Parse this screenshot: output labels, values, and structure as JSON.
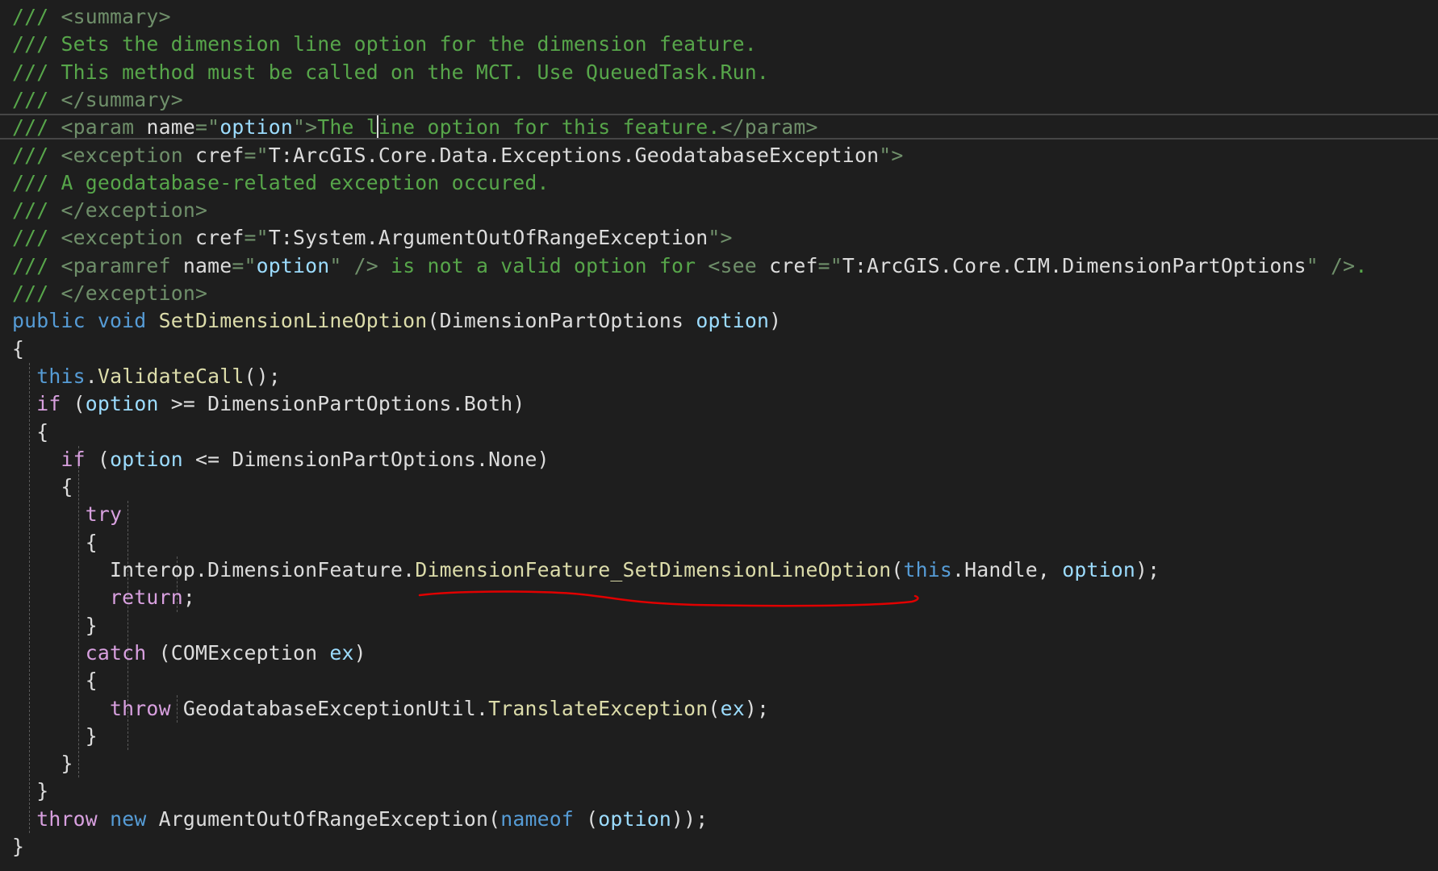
{
  "editor": {
    "language": "csharp",
    "lines": [
      [
        [
          "comment",
          "/// "
        ],
        [
          "xmltag",
          "<summary>"
        ]
      ],
      [
        [
          "comment",
          "/// Sets the dimension line option for the dimension feature."
        ]
      ],
      [
        [
          "comment",
          "/// This method must be called on the MCT. Use QueuedTask.Run."
        ]
      ],
      [
        [
          "comment",
          "/// "
        ],
        [
          "xmltag",
          "</summary>"
        ]
      ],
      [
        [
          "comment",
          "/// "
        ],
        [
          "xmltag",
          "<param "
        ],
        [
          "attr",
          "name"
        ],
        [
          "xmltag",
          "=\""
        ],
        [
          "attrval-b",
          "option"
        ],
        [
          "xmltag",
          "\">"
        ],
        [
          "comment",
          "The line option for this feature."
        ],
        [
          "xmltag",
          "</param>"
        ]
      ],
      [
        [
          "comment",
          "/// "
        ],
        [
          "xmltag",
          "<exception "
        ],
        [
          "attr",
          "cref"
        ],
        [
          "xmltag",
          "=\""
        ],
        [
          "attrval",
          "T:ArcGIS.Core.Data.Exceptions.GeodatabaseException"
        ],
        [
          "xmltag",
          "\">"
        ]
      ],
      [
        [
          "comment",
          "/// A geodatabase-related exception occured."
        ]
      ],
      [
        [
          "comment",
          "/// "
        ],
        [
          "xmltag",
          "</exception>"
        ]
      ],
      [
        [
          "comment",
          "/// "
        ],
        [
          "xmltag",
          "<exception "
        ],
        [
          "attr",
          "cref"
        ],
        [
          "xmltag",
          "=\""
        ],
        [
          "attrval",
          "T:System.ArgumentOutOfRangeException"
        ],
        [
          "xmltag",
          "\">"
        ]
      ],
      [
        [
          "comment",
          "/// "
        ],
        [
          "xmltag",
          "<paramref "
        ],
        [
          "attr",
          "name"
        ],
        [
          "xmltag",
          "=\""
        ],
        [
          "attrval-b",
          "option"
        ],
        [
          "xmltag",
          "\" />"
        ],
        [
          "comment",
          " is not a valid option for "
        ],
        [
          "xmltag",
          "<see "
        ],
        [
          "attr",
          "cref"
        ],
        [
          "xmltag",
          "=\""
        ],
        [
          "attrval",
          "T:ArcGIS.Core.CIM.DimensionPartOptions"
        ],
        [
          "xmltag",
          "\" />"
        ],
        [
          "comment",
          "."
        ]
      ],
      [
        [
          "comment",
          "/// "
        ],
        [
          "xmltag",
          "</exception>"
        ]
      ],
      [
        [
          "keyword",
          "public"
        ],
        [
          "plain",
          " "
        ],
        [
          "keyword",
          "void"
        ],
        [
          "plain",
          " "
        ],
        [
          "method",
          "SetDimensionLineOption"
        ],
        [
          "plain",
          "("
        ],
        [
          "type",
          "DimensionPartOptions"
        ],
        [
          "plain",
          " "
        ],
        [
          "param",
          "option"
        ],
        [
          "plain",
          ")"
        ]
      ],
      [
        [
          "plain",
          "{"
        ]
      ],
      [
        [
          "plain",
          "  "
        ],
        [
          "keyword",
          "this"
        ],
        [
          "plain",
          "."
        ],
        [
          "method",
          "ValidateCall"
        ],
        [
          "plain",
          "();"
        ]
      ],
      [
        [
          "plain",
          "  "
        ],
        [
          "control",
          "if"
        ],
        [
          "plain",
          " ("
        ],
        [
          "param",
          "option"
        ],
        [
          "plain",
          " >= "
        ],
        [
          "type",
          "DimensionPartOptions"
        ],
        [
          "plain",
          ".Both)"
        ]
      ],
      [
        [
          "plain",
          "  {"
        ]
      ],
      [
        [
          "plain",
          "    "
        ],
        [
          "control",
          "if"
        ],
        [
          "plain",
          " ("
        ],
        [
          "param",
          "option"
        ],
        [
          "plain",
          " <= "
        ],
        [
          "type",
          "DimensionPartOptions"
        ],
        [
          "plain",
          ".None)"
        ]
      ],
      [
        [
          "plain",
          "    {"
        ]
      ],
      [
        [
          "plain",
          "      "
        ],
        [
          "control",
          "try"
        ]
      ],
      [
        [
          "plain",
          "      {"
        ]
      ],
      [
        [
          "plain",
          "        "
        ],
        [
          "type",
          "Interop"
        ],
        [
          "plain",
          "."
        ],
        [
          "type",
          "DimensionFeature"
        ],
        [
          "plain",
          "."
        ],
        [
          "method",
          "DimensionFeature_SetDimensionLineOption"
        ],
        [
          "plain",
          "("
        ],
        [
          "keyword",
          "this"
        ],
        [
          "plain",
          ".Handle, "
        ],
        [
          "param",
          "option"
        ],
        [
          "plain",
          ");"
        ]
      ],
      [
        [
          "plain",
          "        "
        ],
        [
          "control",
          "return"
        ],
        [
          "plain",
          ";"
        ]
      ],
      [
        [
          "plain",
          "      }"
        ]
      ],
      [
        [
          "plain",
          "      "
        ],
        [
          "control",
          "catch"
        ],
        [
          "plain",
          " ("
        ],
        [
          "type",
          "COMException"
        ],
        [
          "plain",
          " "
        ],
        [
          "param",
          "ex"
        ],
        [
          "plain",
          ")"
        ]
      ],
      [
        [
          "plain",
          "      {"
        ]
      ],
      [
        [
          "plain",
          "        "
        ],
        [
          "control",
          "throw"
        ],
        [
          "plain",
          " "
        ],
        [
          "type",
          "GeodatabaseExceptionUtil"
        ],
        [
          "plain",
          "."
        ],
        [
          "method",
          "TranslateException"
        ],
        [
          "plain",
          "("
        ],
        [
          "param",
          "ex"
        ],
        [
          "plain",
          ");"
        ]
      ],
      [
        [
          "plain",
          "      }"
        ]
      ],
      [
        [
          "plain",
          "    }"
        ]
      ],
      [
        [
          "plain",
          "  }"
        ]
      ],
      [
        [
          "plain",
          "  "
        ],
        [
          "control",
          "throw"
        ],
        [
          "plain",
          " "
        ],
        [
          "keyword",
          "new"
        ],
        [
          "plain",
          " "
        ],
        [
          "type",
          "ArgumentOutOfRangeException"
        ],
        [
          "plain",
          "("
        ],
        [
          "keyword",
          "nameof"
        ],
        [
          "plain",
          " ("
        ],
        [
          "param",
          "option"
        ],
        [
          "plain",
          "));"
        ]
      ],
      [
        [
          "plain",
          "}"
        ]
      ]
    ],
    "current_line": 4,
    "colors": {
      "background": "#1e1e1e",
      "comment": "#57a64a",
      "keyword": "#569cd6",
      "control": "#d8a0df",
      "method": "#dcdcaa",
      "parameter": "#9cdcfe",
      "text": "#dcdcdc",
      "annotation": "#e00000"
    },
    "annotation": {
      "kind": "hand-drawn-underline",
      "target": "DimensionFeature_SetDimensionLineOption"
    }
  }
}
